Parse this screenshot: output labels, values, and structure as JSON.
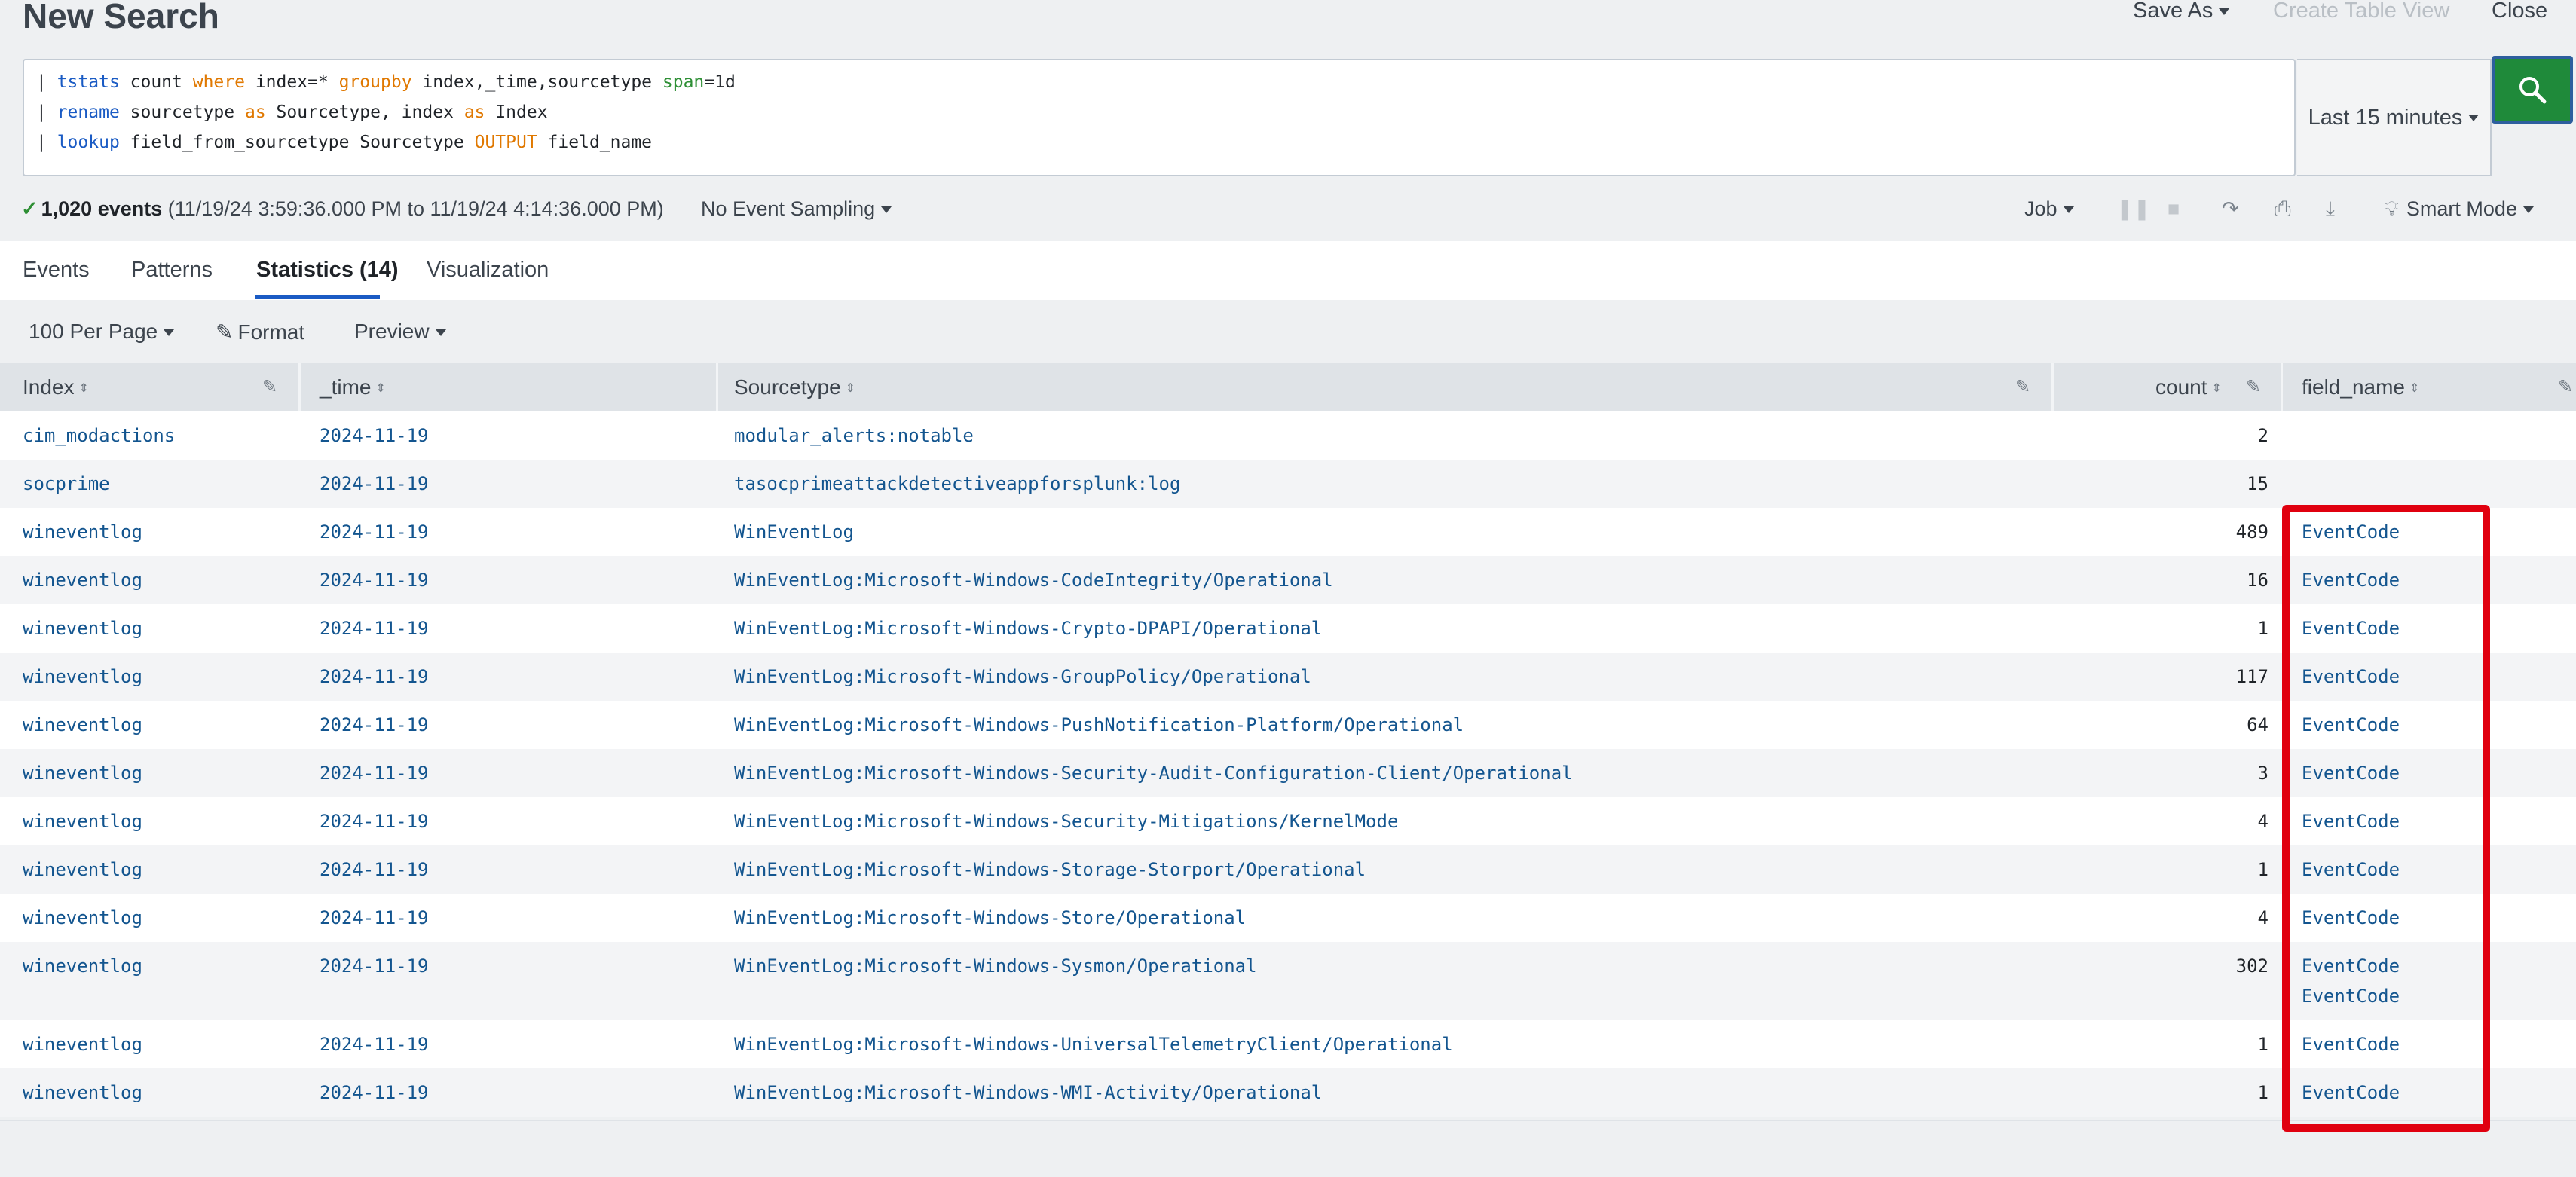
{
  "header": {
    "title": "New Search",
    "save_as": "Save As",
    "create_table_view": "Create Table View",
    "close": "Close"
  },
  "search": {
    "lines": [
      [
        {
          "t": "| ",
          "c": "plain"
        },
        {
          "t": "tstats",
          "c": "blue"
        },
        {
          "t": " count ",
          "c": "plain"
        },
        {
          "t": "where",
          "c": "orange"
        },
        {
          "t": " index=* ",
          "c": "plain"
        },
        {
          "t": "groupby",
          "c": "orange"
        },
        {
          "t": " index,_time,sourcetype ",
          "c": "plain"
        },
        {
          "t": "span",
          "c": "green"
        },
        {
          "t": "=1d",
          "c": "plain"
        }
      ],
      [
        {
          "t": "| ",
          "c": "plain"
        },
        {
          "t": "rename",
          "c": "blue"
        },
        {
          "t": " sourcetype ",
          "c": "plain"
        },
        {
          "t": "as",
          "c": "orange"
        },
        {
          "t": " Sourcetype, index ",
          "c": "plain"
        },
        {
          "t": "as",
          "c": "orange"
        },
        {
          "t": " Index",
          "c": "plain"
        }
      ],
      [
        {
          "t": "| ",
          "c": "plain"
        },
        {
          "t": "lookup",
          "c": "blue"
        },
        {
          "t": " field_from_sourcetype Sourcetype ",
          "c": "plain"
        },
        {
          "t": "OUTPUT",
          "c": "orange"
        },
        {
          "t": " field_name",
          "c": "plain"
        }
      ]
    ],
    "time_range": "Last 15 minutes"
  },
  "status": {
    "event_count": "1,020 events",
    "range": "(11/19/24 3:59:36.000 PM to 11/19/24 4:14:36.000 PM)",
    "sampling": "No Event Sampling",
    "job": "Job",
    "mode": "Smart Mode"
  },
  "tabs": [
    {
      "label": "Events"
    },
    {
      "label": "Patterns"
    },
    {
      "label": "Statistics (14)"
    },
    {
      "label": "Visualization"
    }
  ],
  "controls": {
    "per_page": "100 Per Page",
    "format": "Format",
    "preview": "Preview"
  },
  "table": {
    "columns": [
      "Index",
      "_time",
      "Sourcetype",
      "count",
      "field_name"
    ],
    "rows": [
      {
        "index": "cim_modactions",
        "time": "2024-11-19",
        "sourcetype": "modular_alerts:notable",
        "count": "2",
        "field_name": []
      },
      {
        "index": "socprime",
        "time": "2024-11-19",
        "sourcetype": "tasocprimeattackdetectiveappforsplunk:log",
        "count": "15",
        "field_name": []
      },
      {
        "index": "wineventlog",
        "time": "2024-11-19",
        "sourcetype": "WinEventLog",
        "count": "489",
        "field_name": [
          "EventCode"
        ]
      },
      {
        "index": "wineventlog",
        "time": "2024-11-19",
        "sourcetype": "WinEventLog:Microsoft-Windows-CodeIntegrity/Operational",
        "count": "16",
        "field_name": [
          "EventCode"
        ]
      },
      {
        "index": "wineventlog",
        "time": "2024-11-19",
        "sourcetype": "WinEventLog:Microsoft-Windows-Crypto-DPAPI/Operational",
        "count": "1",
        "field_name": [
          "EventCode"
        ]
      },
      {
        "index": "wineventlog",
        "time": "2024-11-19",
        "sourcetype": "WinEventLog:Microsoft-Windows-GroupPolicy/Operational",
        "count": "117",
        "field_name": [
          "EventCode"
        ]
      },
      {
        "index": "wineventlog",
        "time": "2024-11-19",
        "sourcetype": "WinEventLog:Microsoft-Windows-PushNotification-Platform/Operational",
        "count": "64",
        "field_name": [
          "EventCode"
        ]
      },
      {
        "index": "wineventlog",
        "time": "2024-11-19",
        "sourcetype": "WinEventLog:Microsoft-Windows-Security-Audit-Configuration-Client/Operational",
        "count": "3",
        "field_name": [
          "EventCode"
        ]
      },
      {
        "index": "wineventlog",
        "time": "2024-11-19",
        "sourcetype": "WinEventLog:Microsoft-Windows-Security-Mitigations/KernelMode",
        "count": "4",
        "field_name": [
          "EventCode"
        ]
      },
      {
        "index": "wineventlog",
        "time": "2024-11-19",
        "sourcetype": "WinEventLog:Microsoft-Windows-Storage-Storport/Operational",
        "count": "1",
        "field_name": [
          "EventCode"
        ]
      },
      {
        "index": "wineventlog",
        "time": "2024-11-19",
        "sourcetype": "WinEventLog:Microsoft-Windows-Store/Operational",
        "count": "4",
        "field_name": [
          "EventCode"
        ]
      },
      {
        "index": "wineventlog",
        "time": "2024-11-19",
        "sourcetype": "WinEventLog:Microsoft-Windows-Sysmon/Operational",
        "count": "302",
        "field_name": [
          "EventCode",
          "EventCode"
        ]
      },
      {
        "index": "wineventlog",
        "time": "2024-11-19",
        "sourcetype": "WinEventLog:Microsoft-Windows-UniversalTelemetryClient/Operational",
        "count": "1",
        "field_name": [
          "EventCode"
        ]
      },
      {
        "index": "wineventlog",
        "time": "2024-11-19",
        "sourcetype": "WinEventLog:Microsoft-Windows-WMI-Activity/Operational",
        "count": "1",
        "field_name": [
          "EventCode"
        ]
      }
    ]
  },
  "colors": {
    "accent": "#1a5bc4",
    "search_button": "#1f8a3a",
    "highlight": "#e0000f",
    "link": "#13558f"
  }
}
